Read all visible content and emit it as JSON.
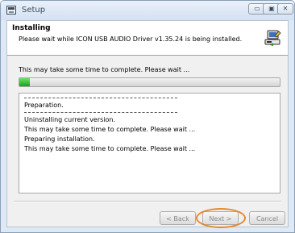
{
  "window": {
    "title": "Setup",
    "controls": {
      "minimize": "▭",
      "maximize": "▣",
      "close": "✕"
    }
  },
  "header": {
    "title": "Installing",
    "subtitle": "Please wait while ICON USB AUDIO Driver v1.35.24 is being installed."
  },
  "status": {
    "text": "This may take some time to complete. Please wait ...",
    "progress_fraction": 0.04
  },
  "log": {
    "lines": [
      "",
      "Preparation.",
      "",
      "Uninstalling current version.",
      "This may take some time to complete. Please wait ...",
      "Preparing installation.",
      "This may take some time to complete. Please wait ..."
    ]
  },
  "buttons": {
    "back": "< Back",
    "next": "Next >",
    "cancel": "Cancel"
  },
  "colors": {
    "progress_fill": "#17a217",
    "highlight_ring": "#e8882a"
  }
}
